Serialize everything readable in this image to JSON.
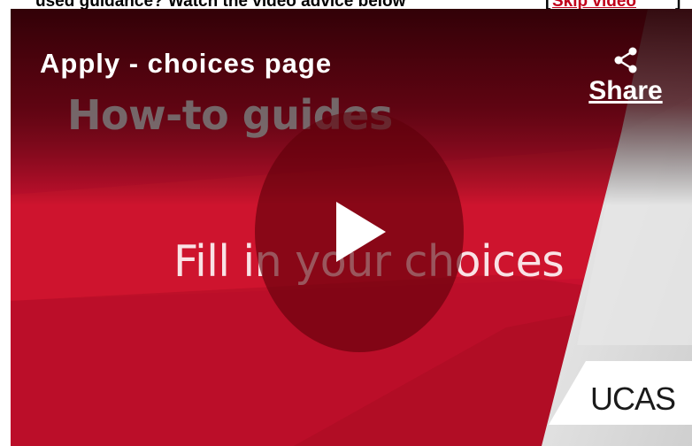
{
  "page_text": {
    "leading": "used guidance? Watch the video advice below",
    "bracket_open": "[",
    "link": "Skip video",
    "bracket_close": "]"
  },
  "video": {
    "title": "Apply - choices page",
    "share_label": "Share",
    "slide_heading": "How-to guides",
    "slide_subtitle": "Fill in your choices",
    "logo_text": "UCAS",
    "play_icon": "play-icon",
    "share_icon": "share-icon"
  },
  "colors": {
    "brand_red": "#c8102e",
    "dark_red": "#5f000a",
    "white": "#ffffff",
    "grey_text": "#787878"
  }
}
